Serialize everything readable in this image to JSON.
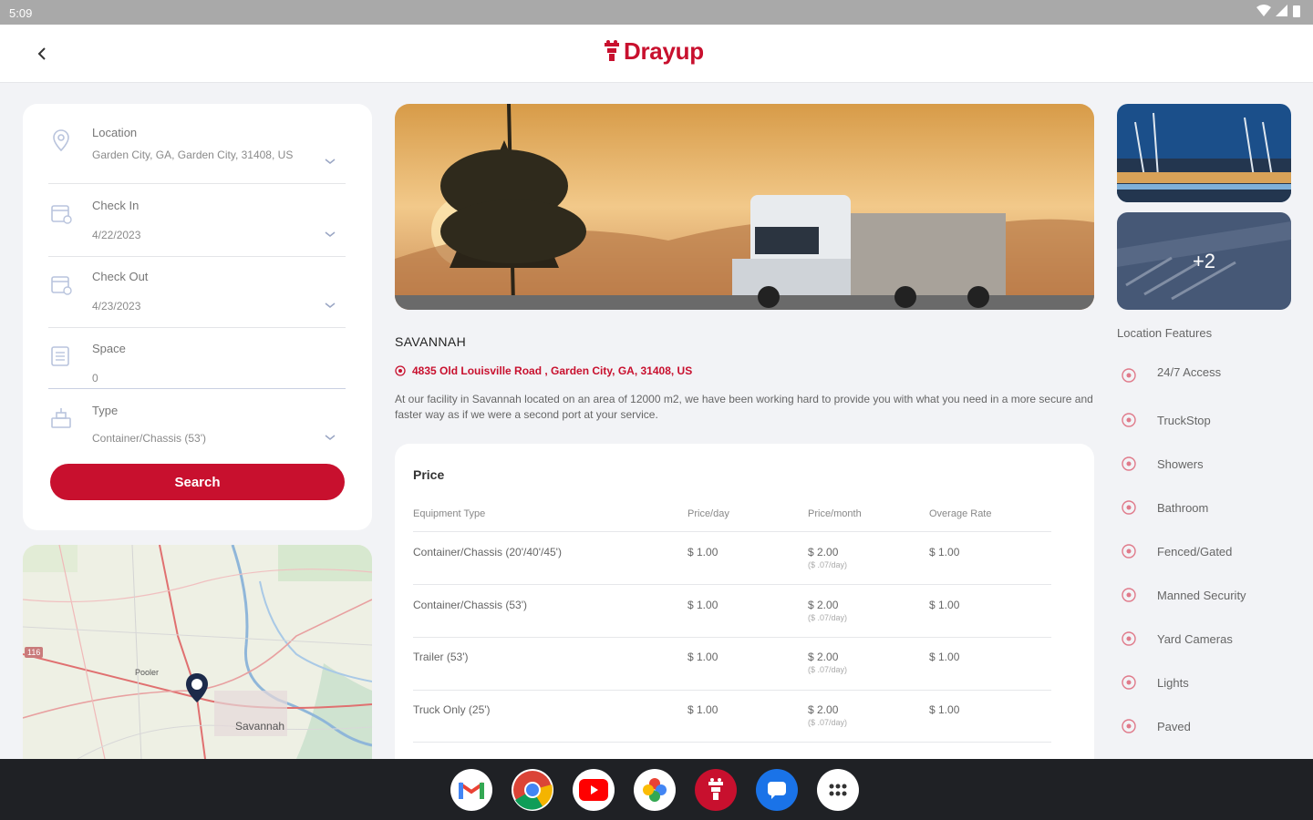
{
  "status_bar": {
    "time": "5:09"
  },
  "app": {
    "brand": "Drayup"
  },
  "search_form": {
    "location": {
      "label": "Location",
      "value": "Garden City, GA, Garden City, 31408, US"
    },
    "check_in": {
      "label": "Check In",
      "value": "4/22/2023"
    },
    "check_out": {
      "label": "Check Out",
      "value": "4/23/2023"
    },
    "space": {
      "label": "Space",
      "value": "0"
    },
    "type": {
      "label": "Type",
      "value": "Container/Chassis (53')"
    },
    "search_label": "Search"
  },
  "map": {
    "city_label": "Savannah",
    "town_label": "Pooler",
    "route_badge": "116"
  },
  "gallery": {
    "more_count": "+2"
  },
  "facility": {
    "name": "SAVANNAH",
    "address": "4835 Old Louisville Road , Garden City, GA, 31408, US",
    "description": "At our facility in Savannah located on an area of 12000 m2, we have been working hard to provide you with what you need in a more secure and faster way as if we were a second port at your service."
  },
  "price": {
    "title": "Price",
    "columns": [
      "Equipment Type",
      "Price/day",
      "Price/month",
      "Overage Rate"
    ],
    "rows": [
      {
        "type": "Container/Chassis (20'/40'/45')",
        "day": "$ 1.00",
        "month": "$ 2.00",
        "month_sub": "($ .07/day)",
        "overage": "$ 1.00"
      },
      {
        "type": "Container/Chassis (53')",
        "day": "$ 1.00",
        "month": "$ 2.00",
        "month_sub": "($ .07/day)",
        "overage": "$ 1.00"
      },
      {
        "type": "Trailer (53')",
        "day": "$ 1.00",
        "month": "$ 2.00",
        "month_sub": "($ .07/day)",
        "overage": "$ 1.00"
      },
      {
        "type": "Truck Only (25')",
        "day": "$ 1.00",
        "month": "$ 2.00",
        "month_sub": "($ .07/day)",
        "overage": "$ 1.00"
      }
    ]
  },
  "features": {
    "title": "Location Features",
    "items": [
      "24/7 Access",
      "TruckStop",
      "Showers",
      "Bathroom",
      "Fenced/Gated",
      "Manned Security",
      "Yard Cameras",
      "Lights",
      "Paved"
    ]
  },
  "dock": {
    "apps": [
      "gmail-icon",
      "chrome-icon",
      "youtube-icon",
      "photos-icon",
      "drayup-icon",
      "messages-icon",
      "app-drawer-icon"
    ]
  },
  "colors": {
    "brand": "#c8102e",
    "background": "#f2f3f6",
    "card": "#ffffff"
  }
}
